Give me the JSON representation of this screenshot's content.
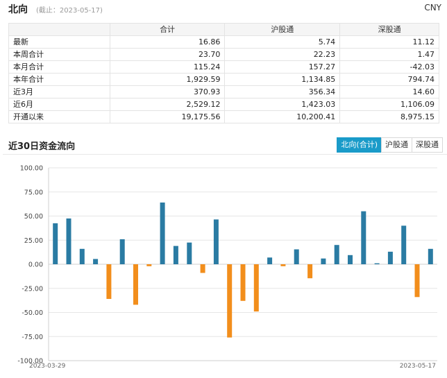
{
  "header": {
    "title": "北向",
    "as_of": "(截止：2023-05-17)",
    "currency": "CNY"
  },
  "table": {
    "columns": [
      "",
      "合计",
      "沪股通",
      "深股通"
    ],
    "rows": [
      {
        "label": "最新",
        "values": [
          "16.86",
          "5.74",
          "11.12"
        ]
      },
      {
        "label": "本周合计",
        "values": [
          "23.70",
          "22.23",
          "1.47"
        ]
      },
      {
        "label": "本月合计",
        "values": [
          "115.24",
          "157.27",
          "-42.03"
        ]
      },
      {
        "label": "本年合计",
        "values": [
          "1,929.59",
          "1,134.85",
          "794.74"
        ]
      },
      {
        "label": "近3月",
        "values": [
          "370.93",
          "356.34",
          "14.60"
        ]
      },
      {
        "label": "近6月",
        "values": [
          "2,529.12",
          "1,423.03",
          "1,106.09"
        ]
      },
      {
        "label": "开通以来",
        "values": [
          "19,175.56",
          "10,200.41",
          "8,975.15"
        ]
      }
    ]
  },
  "section": {
    "title": "近30日资金流向",
    "tabs": [
      {
        "label": "北向(合计)",
        "active": true
      },
      {
        "label": "沪股通",
        "active": false
      },
      {
        "label": "深股通",
        "active": false
      }
    ]
  },
  "chart_data": {
    "type": "bar",
    "x_start_label": "2023-03-29",
    "x_end_label": "2023-05-17",
    "values": [
      42.5,
      47.5,
      16,
      5.5,
      -36,
      26,
      -42,
      -2,
      64,
      19,
      22.5,
      -9,
      46.5,
      -76,
      -38,
      -49,
      7,
      -2,
      15.5,
      -14.5,
      6,
      20,
      9.5,
      55,
      1,
      13,
      40,
      -34,
      16
    ],
    "ylim": [
      -100,
      100
    ],
    "yticks": [
      "100.00",
      "75.00",
      "50.00",
      "25.00",
      "0.00",
      "-25.00",
      "-50.00",
      "-75.00",
      "-100.00"
    ],
    "grid": true,
    "colors": {
      "positive": "#2a7ba3",
      "negative": "#f28e1c"
    }
  }
}
